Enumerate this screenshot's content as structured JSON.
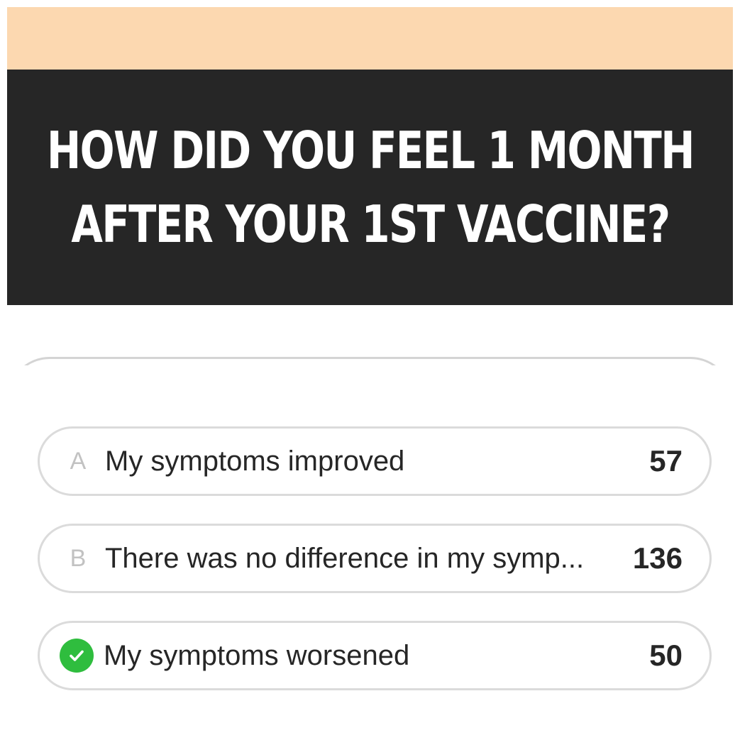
{
  "story": {
    "question_line1": "HOW DID YOU FEEL 1 MONTH",
    "question_line2": "AFTER YOUR 1ST VACCINE?",
    "top_color": "#fcd8b0",
    "card_color": "#262626"
  },
  "quiz": {
    "options": [
      {
        "letter": "A",
        "label": "My symptoms improved",
        "count": "57",
        "correct": false
      },
      {
        "letter": "B",
        "label": "There was no difference in my symp...",
        "count": "136",
        "correct": false
      },
      {
        "letter": "",
        "label": "My symptoms worsened",
        "count": "50",
        "correct": true,
        "icon": "check-circle-icon"
      }
    ],
    "correct_color": "#2fbd3e"
  }
}
